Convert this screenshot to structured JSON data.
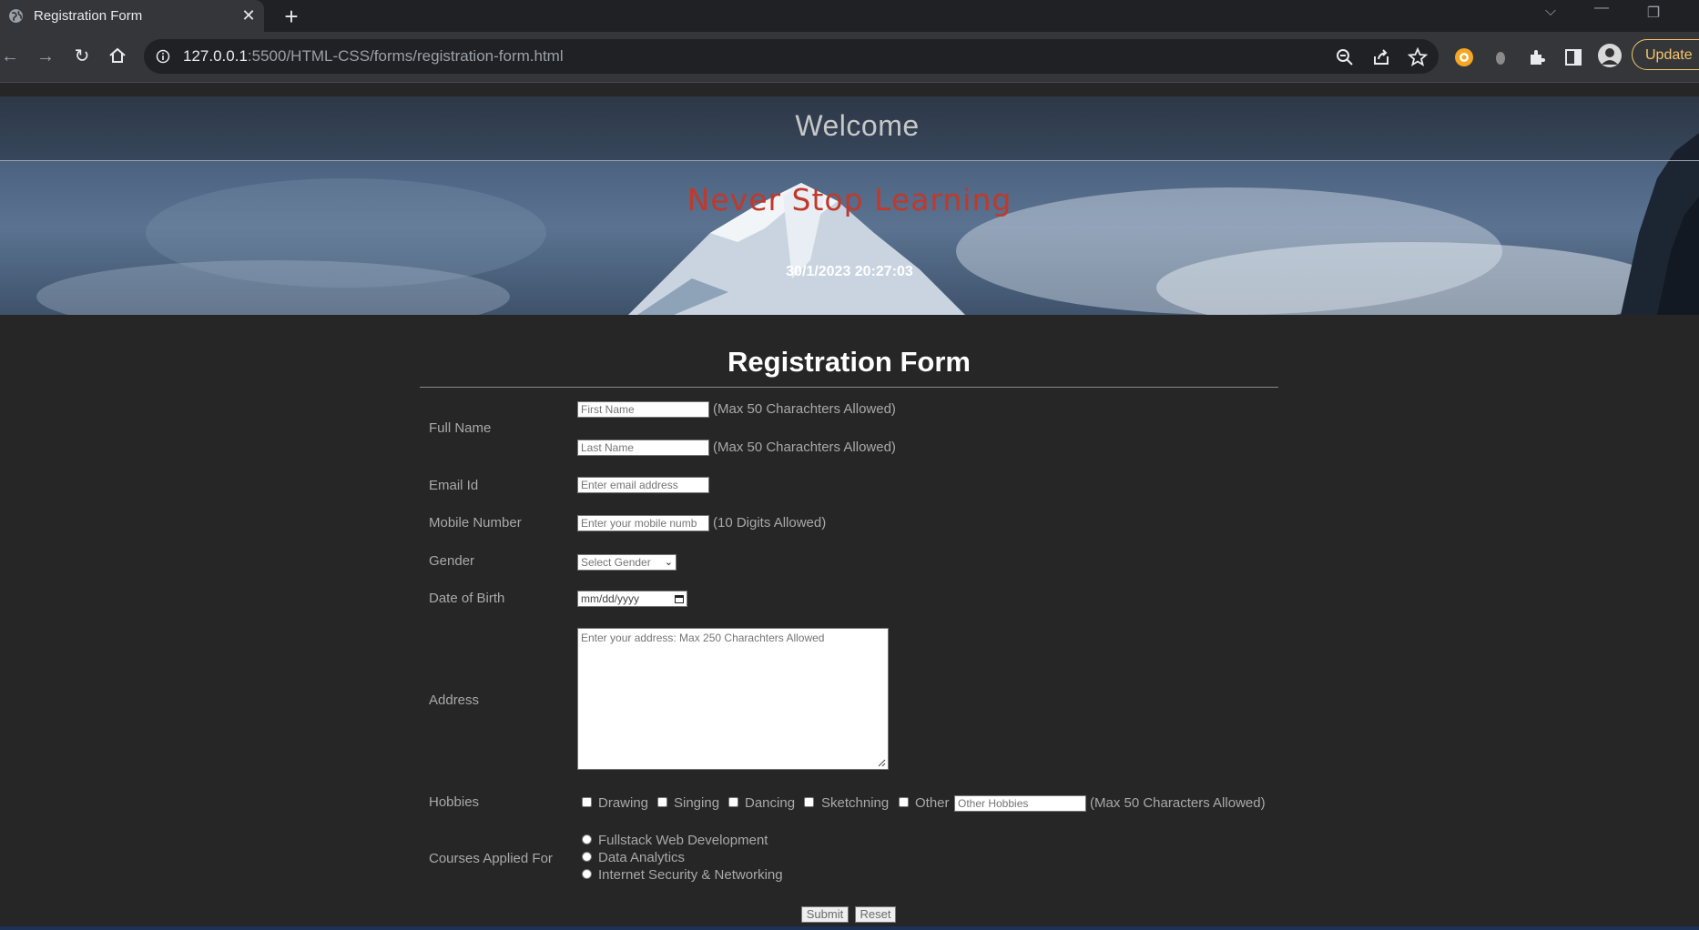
{
  "browser": {
    "tab_title": "Registration Form",
    "url_host": "127.0.0.1",
    "url_rest": ":5500/HTML-CSS/forms/registration-form.html",
    "update_label": "Update"
  },
  "header": {
    "welcome": "Welcome",
    "motto": "Never Stop Learning",
    "datetime": "30/1/2023 20:27:03"
  },
  "form": {
    "title": "Registration Form",
    "full_name": {
      "label": "Full Name",
      "first_placeholder": "First Name",
      "last_placeholder": "Last Name",
      "hint": "(Max 50 Charachters Allowed)"
    },
    "email": {
      "label": "Email Id",
      "placeholder": "Enter email address"
    },
    "mobile": {
      "label": "Mobile Number",
      "placeholder": "Enter your mobile numb",
      "hint": "(10 Digits Allowed)"
    },
    "gender": {
      "label": "Gender",
      "selected": "Select Gender"
    },
    "dob": {
      "label": "Date of Birth",
      "placeholder": "mm/dd/yyyy"
    },
    "address": {
      "label": "Address",
      "placeholder": "Enter your address: Max 250 Charachters Allowed"
    },
    "hobbies": {
      "label": "Hobbies",
      "options": [
        "Drawing",
        "Singing",
        "Dancing",
        "Sketchning",
        "Other"
      ],
      "other_placeholder": "Other Hobbies",
      "hint": "(Max 50 Characters Allowed)"
    },
    "courses": {
      "label": "Courses Applied For",
      "options": [
        "Fullstack Web Development",
        "Data Analytics",
        "Internet Security & Networking"
      ]
    },
    "submit_label": "Submit",
    "reset_label": "Reset"
  },
  "colors": {
    "page_bg": "#262626",
    "label_text": "#a9a9a9",
    "motto": "#c0392b",
    "update_accent": "#f5c66b"
  },
  "icons": [
    "globe-icon",
    "close-icon",
    "plus-icon",
    "back-icon",
    "forward-icon",
    "reload-icon",
    "home-icon",
    "info-icon",
    "zoom-out-icon",
    "share-icon",
    "star-icon",
    "extension-icon",
    "puzzle-icon",
    "sidebar-icon",
    "avatar",
    "calendar-icon"
  ]
}
